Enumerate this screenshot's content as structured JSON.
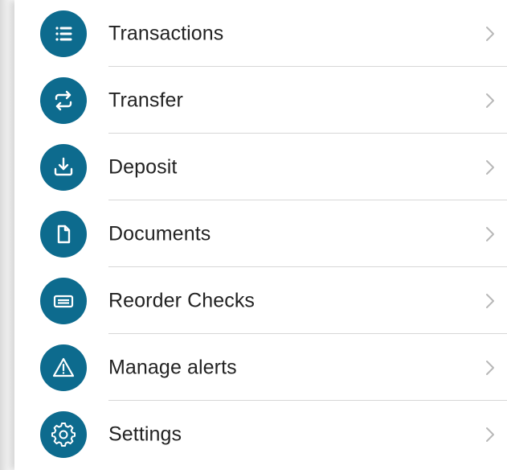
{
  "colors": {
    "icon_background": "#0d6b8e",
    "icon_glyph": "#ffffff",
    "label_text": "#222222",
    "chevron": "#b8b8b8",
    "divider": "#d7d7d7"
  },
  "menu": {
    "items": [
      {
        "label": "Transactions",
        "icon": "list-icon"
      },
      {
        "label": "Transfer",
        "icon": "transfer-arrows-icon"
      },
      {
        "label": "Deposit",
        "icon": "download-tray-icon"
      },
      {
        "label": "Documents",
        "icon": "document-icon"
      },
      {
        "label": "Reorder Checks",
        "icon": "check-card-icon"
      },
      {
        "label": "Manage alerts",
        "icon": "warning-triangle-icon"
      },
      {
        "label": "Settings",
        "icon": "gear-icon"
      }
    ]
  }
}
